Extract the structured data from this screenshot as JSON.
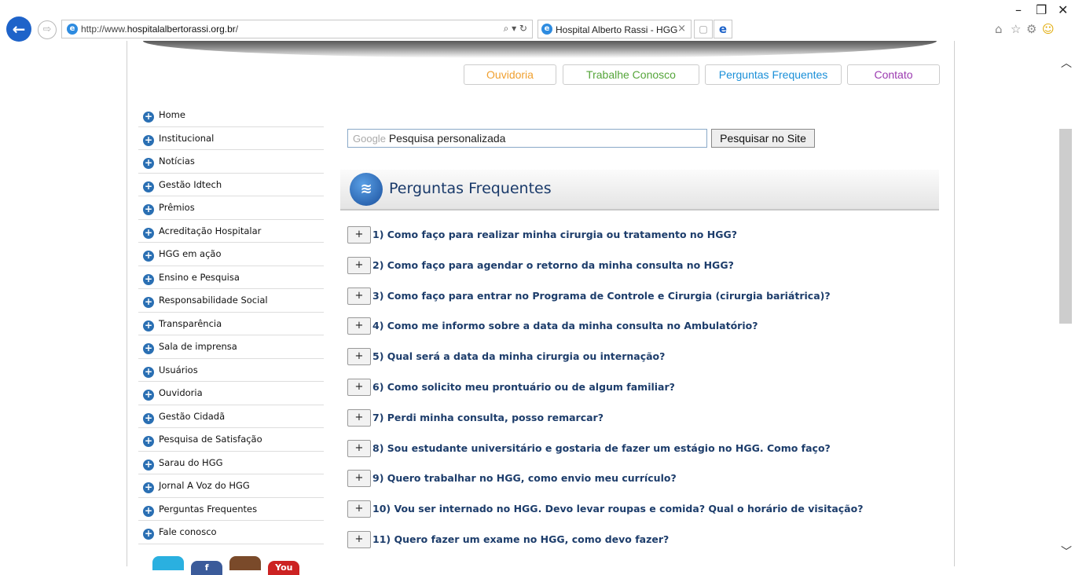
{
  "browser": {
    "url_prefix": "http://www.",
    "url_domain": "hospitalalbertorassi.org.br",
    "url_suffix": "/",
    "tab_title": "Hospital Alberto Rassi - HGG",
    "back_icon": "←",
    "forward_icon": "⇨",
    "search_refresh": "⌕ ▾ ↻",
    "tab_close": "×",
    "minimize": "–",
    "restore": "❐",
    "close": "✕",
    "home_icon": "⌂",
    "star_icon": "☆",
    "gear_icon": "⚙",
    "smiley_icon": "☺"
  },
  "topnav": [
    {
      "label": "Ouvidoria",
      "color": "#f0a030"
    },
    {
      "label": "Trabalhe Conosco",
      "color": "#55a53a"
    },
    {
      "label": "Perguntas Frequentes",
      "color": "#1a8fd8"
    },
    {
      "label": "Contato",
      "color": "#9b3ab0"
    }
  ],
  "sidebar": {
    "items": [
      "Home",
      "Institucional",
      "Notícias",
      "Gestão Idtech",
      "Prêmios",
      "Acreditação Hospitalar",
      "HGG em ação",
      "Ensino e Pesquisa",
      "Responsabilidade Social",
      "Transparência",
      "Sala de imprensa",
      "Usuários",
      "Ouvidoria",
      "Gestão Cidadã",
      "Pesquisa de Satisfação",
      "Sarau do HGG",
      "Jornal A Voz do HGG",
      "Perguntas Frequentes",
      "Fale conosco"
    ]
  },
  "social": [
    "",
    "f",
    "",
    "You"
  ],
  "search": {
    "google_label": "Google",
    "placeholder": "Pesquisa personalizada",
    "button": "Pesquisar no Site"
  },
  "section": {
    "title": "Perguntas Frequentes"
  },
  "faq": [
    "1) Como faço para realizar minha cirurgia ou tratamento no HGG?",
    "2) Como faço para agendar o retorno da minha consulta no HGG?",
    "3) Como faço para entrar no Programa de Controle e Cirurgia (cirurgia bariátrica)?",
    "4) Como me informo sobre a data da minha consulta no Ambulatório?",
    "5) Qual será a data da minha cirurgia ou internação?",
    "6) Como solicito meu prontuário ou de algum familiar?",
    "7) Perdi minha consulta, posso remarcar?",
    "8) Sou estudante universitário e gostaria de fazer um estágio no HGG. Como faço?",
    "9) Quero trabalhar no HGG, como envio meu currículo?",
    "10) Vou ser internado no HGG. Devo levar roupas e comida? Qual o horário de visitação?",
    "11) Quero fazer um exame no HGG, como devo fazer?"
  ],
  "plus_label": "+"
}
